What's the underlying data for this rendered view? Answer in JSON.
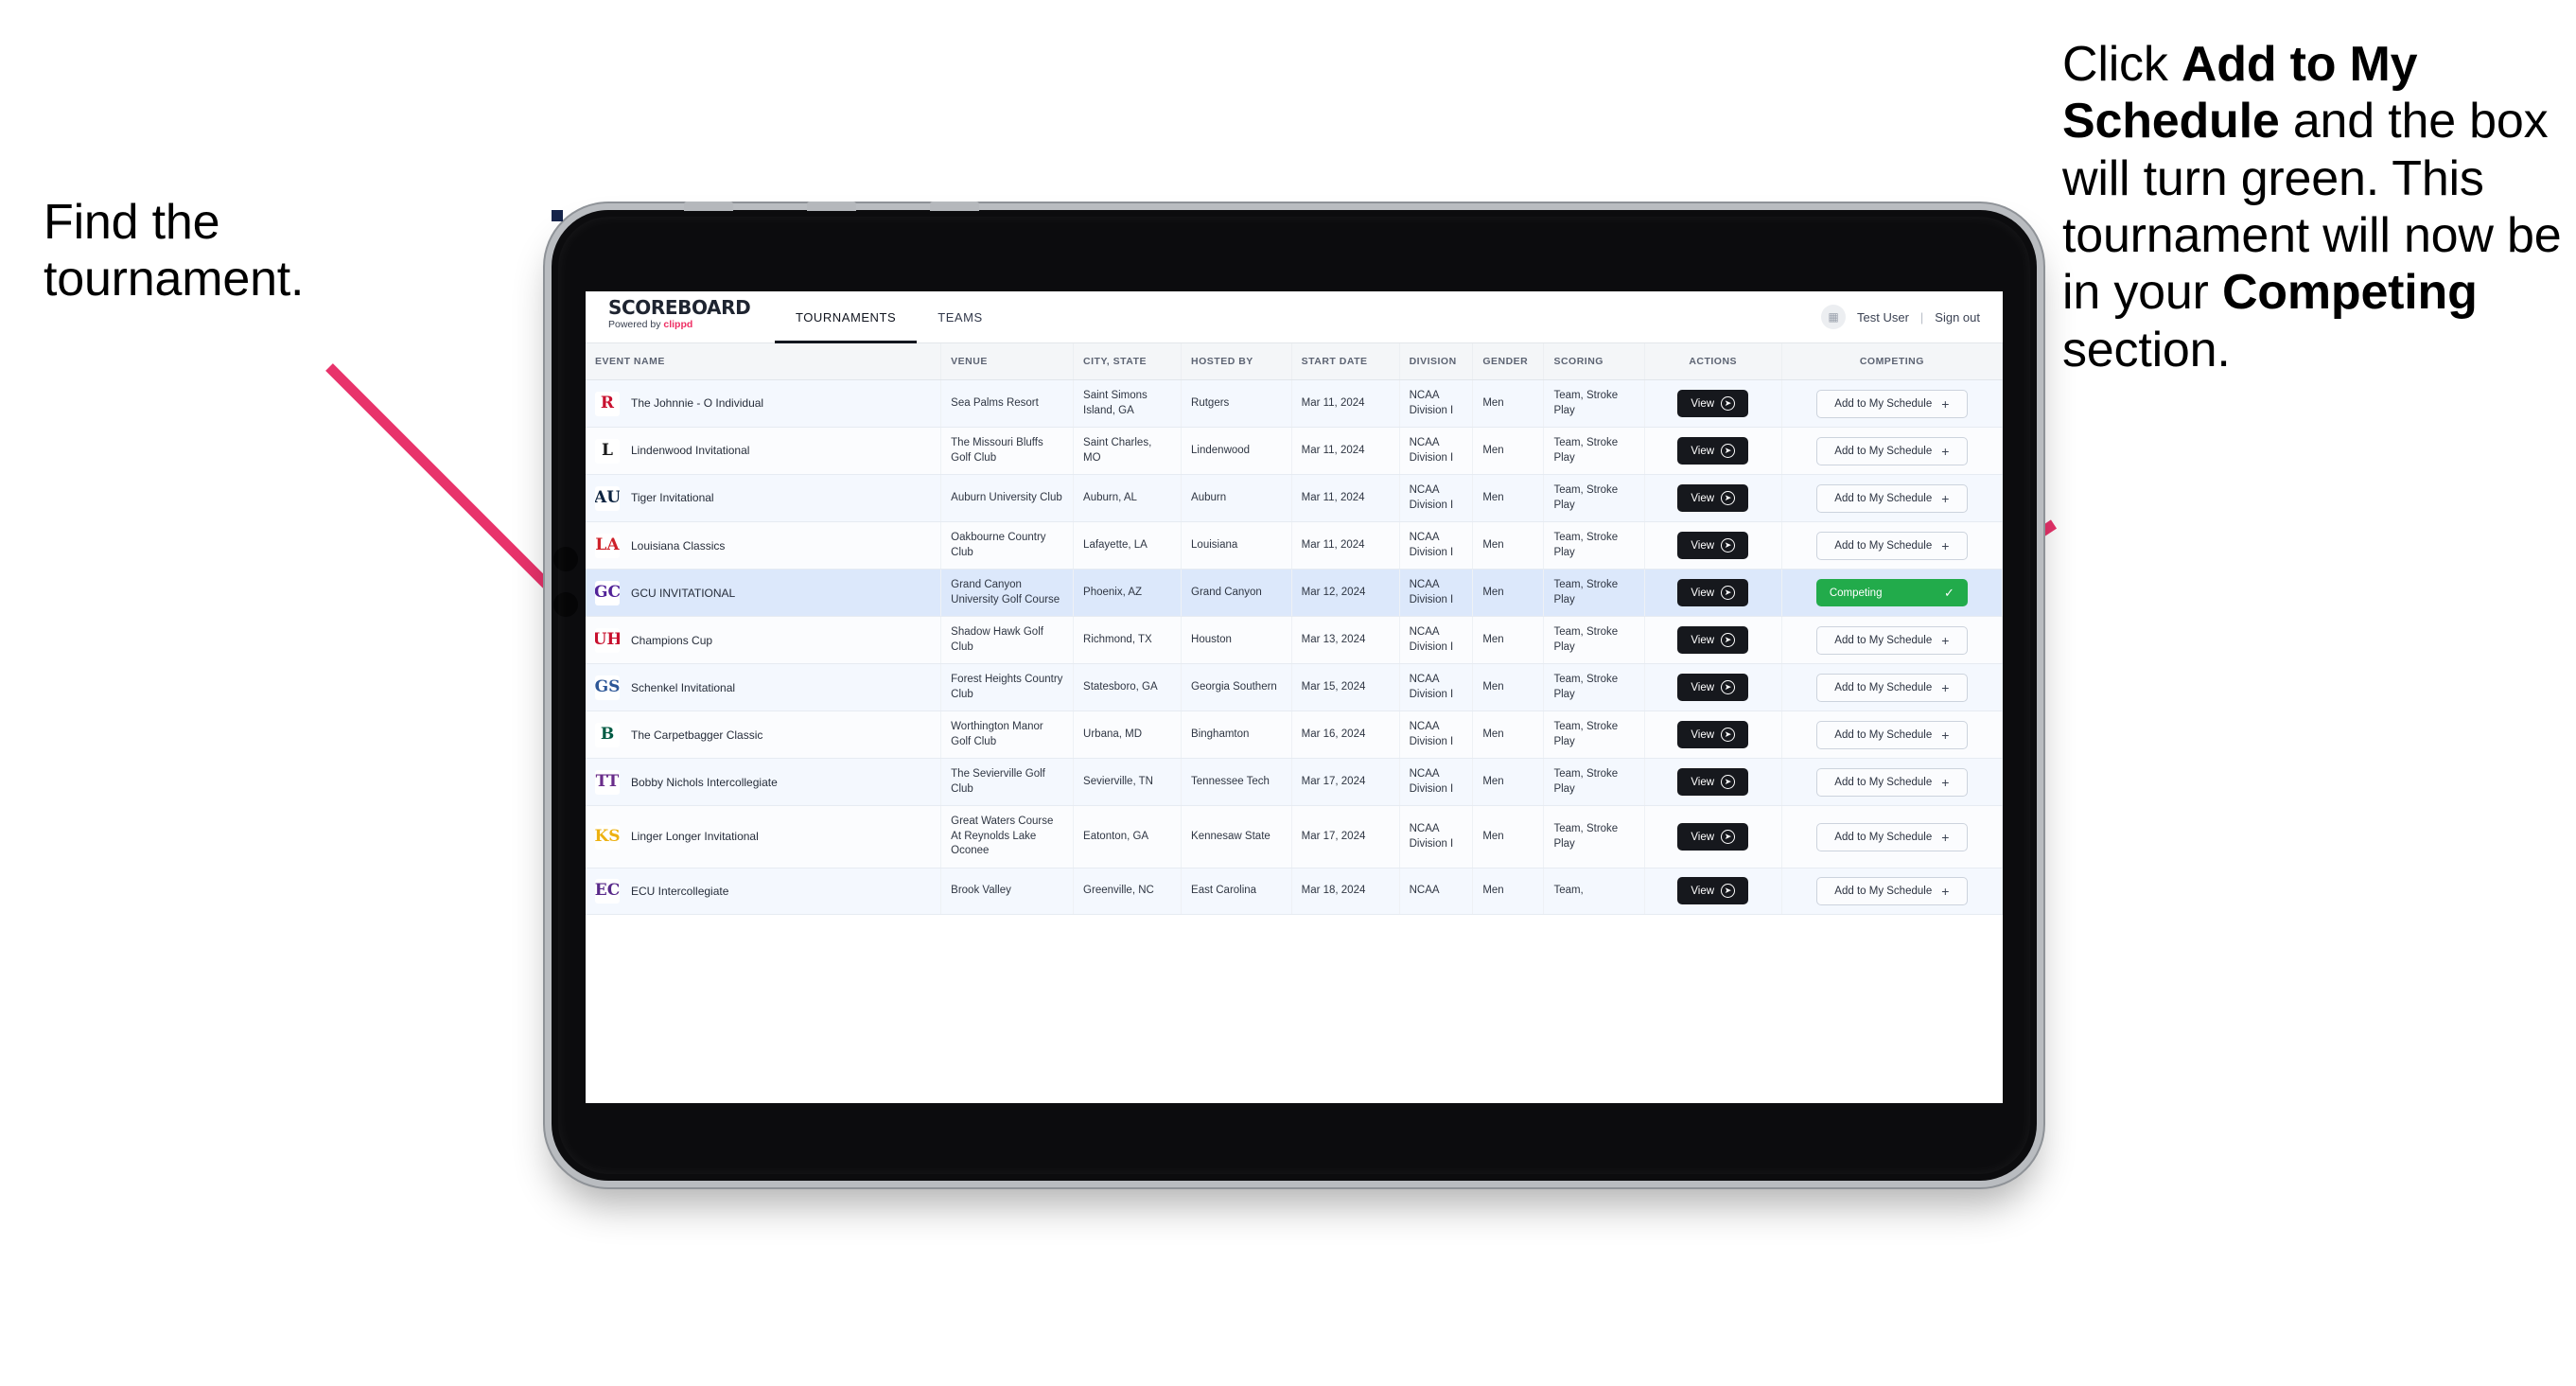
{
  "annotations": {
    "left": "Find the tournament.",
    "right_parts": [
      {
        "t": "Click ",
        "b": false
      },
      {
        "t": "Add to My Schedule",
        "b": true
      },
      {
        "t": " and the box will turn green. This tournament will now be in your ",
        "b": false
      },
      {
        "t": "Competing",
        "b": true
      },
      {
        "t": " section.",
        "b": false
      }
    ]
  },
  "colors": {
    "accent_pink": "#ee2e63",
    "arrow_pink": "#e8336b",
    "competing_green": "#22ab4b",
    "row_highlight": "#dce8fb",
    "dark_button": "#16181d"
  },
  "app": {
    "brand": {
      "title": "SCOREBOARD",
      "powered_prefix": "Powered by ",
      "powered_name": "clippd"
    },
    "nav": [
      {
        "label": "TOURNAMENTS",
        "active": true
      },
      {
        "label": "TEAMS",
        "active": false
      }
    ],
    "user": {
      "avatar_icon": "user-tile-icon",
      "name": "Test User",
      "separator": "|",
      "signout": "Sign out"
    },
    "table": {
      "columns": [
        "EVENT NAME",
        "VENUE",
        "CITY, STATE",
        "HOSTED BY",
        "START DATE",
        "DIVISION",
        "GENDER",
        "SCORING",
        "ACTIONS",
        "COMPETING"
      ],
      "view_label": "View",
      "add_label": "Add to My Schedule",
      "competing_label": "Competing",
      "rows": [
        {
          "logo": "R",
          "logo_bg": "#ffffff",
          "logo_fg": "#c8102e",
          "event": "The Johnnie - O Individual",
          "venue": "Sea Palms Resort",
          "city": "Saint Simons Island, GA",
          "host": "Rutgers",
          "date": "Mar 11, 2024",
          "division": "NCAA Division I",
          "gender": "Men",
          "scoring": "Team, Stroke Play",
          "competing": false
        },
        {
          "logo": "L",
          "logo_bg": "#ffffff",
          "logo_fg": "#1a1a1a",
          "event": "Lindenwood Invitational",
          "venue": "The Missouri Bluffs Golf Club",
          "city": "Saint Charles, MO",
          "host": "Lindenwood",
          "date": "Mar 11, 2024",
          "division": "NCAA Division I",
          "gender": "Men",
          "scoring": "Team, Stroke Play",
          "competing": false
        },
        {
          "logo": "AU",
          "logo_bg": "#ffffff",
          "logo_fg": "#0c2340",
          "event": "Tiger Invitational",
          "venue": "Auburn University Club",
          "city": "Auburn, AL",
          "host": "Auburn",
          "date": "Mar 11, 2024",
          "division": "NCAA Division I",
          "gender": "Men",
          "scoring": "Team, Stroke Play",
          "competing": false
        },
        {
          "logo": "LA",
          "logo_bg": "#ffffff",
          "logo_fg": "#ce2029",
          "event": "Louisiana Classics",
          "venue": "Oakbourne Country Club",
          "city": "Lafayette, LA",
          "host": "Louisiana",
          "date": "Mar 11, 2024",
          "division": "NCAA Division I",
          "gender": "Men",
          "scoring": "Team, Stroke Play",
          "competing": false
        },
        {
          "logo": "GC",
          "logo_bg": "#ffffff",
          "logo_fg": "#522398",
          "event": "GCU INVITATIONAL",
          "venue": "Grand Canyon University Golf Course",
          "city": "Phoenix, AZ",
          "host": "Grand Canyon",
          "date": "Mar 12, 2024",
          "division": "NCAA Division I",
          "gender": "Men",
          "scoring": "Team, Stroke Play",
          "competing": true,
          "highlight": true
        },
        {
          "logo": "UH",
          "logo_bg": "#ffffff",
          "logo_fg": "#c8102e",
          "event": "Champions Cup",
          "venue": "Shadow Hawk Golf Club",
          "city": "Richmond, TX",
          "host": "Houston",
          "date": "Mar 13, 2024",
          "division": "NCAA Division I",
          "gender": "Men",
          "scoring": "Team, Stroke Play",
          "competing": false
        },
        {
          "logo": "GS",
          "logo_bg": "#ffffff",
          "logo_fg": "#2c5697",
          "event": "Schenkel Invitational",
          "venue": "Forest Heights Country Club",
          "city": "Statesboro, GA",
          "host": "Georgia Southern",
          "date": "Mar 15, 2024",
          "division": "NCAA Division I",
          "gender": "Men",
          "scoring": "Team, Stroke Play",
          "competing": false
        },
        {
          "logo": "B",
          "logo_bg": "#ffffff",
          "logo_fg": "#005a43",
          "event": "The Carpetbagger Classic",
          "venue": "Worthington Manor Golf Club",
          "city": "Urbana, MD",
          "host": "Binghamton",
          "date": "Mar 16, 2024",
          "division": "NCAA Division I",
          "gender": "Men",
          "scoring": "Team, Stroke Play",
          "competing": false
        },
        {
          "logo": "TT",
          "logo_bg": "#ffffff",
          "logo_fg": "#6a2d8a",
          "event": "Bobby Nichols Intercollegiate",
          "venue": "The Sevierville Golf Club",
          "city": "Sevierville, TN",
          "host": "Tennessee Tech",
          "date": "Mar 17, 2024",
          "division": "NCAA Division I",
          "gender": "Men",
          "scoring": "Team, Stroke Play",
          "competing": false
        },
        {
          "logo": "KS",
          "logo_bg": "#ffffff",
          "logo_fg": "#edb111",
          "event": "Linger Longer Invitational",
          "venue": "Great Waters Course At Reynolds Lake Oconee",
          "city": "Eatonton, GA",
          "host": "Kennesaw State",
          "date": "Mar 17, 2024",
          "division": "NCAA Division I",
          "gender": "Men",
          "scoring": "Team, Stroke Play",
          "competing": false
        },
        {
          "logo": "EC",
          "logo_bg": "#ffffff",
          "logo_fg": "#592a8a",
          "event": "ECU Intercollegiate",
          "venue": "Brook Valley",
          "city": "Greenville, NC",
          "host": "East Carolina",
          "date": "Mar 18, 2024",
          "division": "NCAA",
          "gender": "Men",
          "scoring": "Team,",
          "competing": false,
          "clipped": true
        }
      ]
    }
  }
}
